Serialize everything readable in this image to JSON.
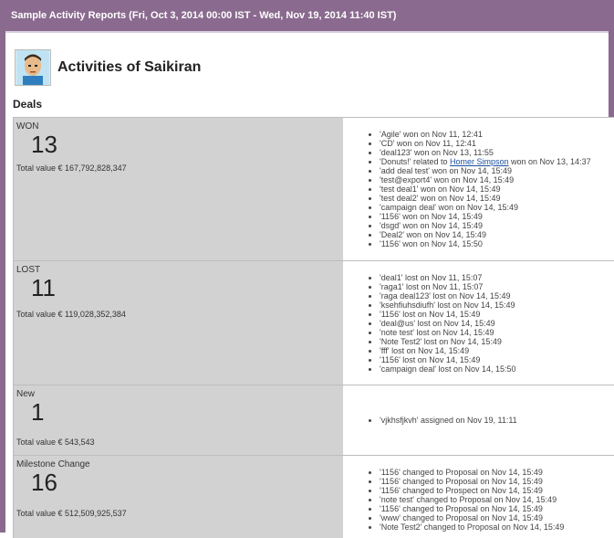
{
  "window": {
    "title": "Sample Activity Reports (Fri, Oct 3, 2014 00:00 IST - Wed, Nov 19, 2014 11:40 IST)"
  },
  "header": {
    "title": "Activities of Saikiran",
    "avatar_icon": "user-avatar-icon"
  },
  "section": {
    "label": "Deals"
  },
  "groups": [
    {
      "name": "WON",
      "count": "13",
      "total": "Total value € 167,792,828,347",
      "items": [
        "'Agile' won on Nov 11, 12:41",
        "'CD' won on Nov 11, 12:41",
        "'deal123' won on Nov 13, 11:55",
        "'add deal test' won on Nov 14, 15:49",
        "'test@export4' won on Nov 14, 15:49",
        "'test deal1' won on Nov 14, 15:49",
        "'test deal2' won on Nov 14, 15:49",
        "'campaign deal' won on Nov 14, 15:49",
        "'1156' won on Nov 14, 15:49",
        "'dsgd' won on Nov 14, 15:49",
        "'Deal2' won on Nov 14, 15:49",
        "'1156' won on Nov 14, 15:50"
      ],
      "special": {
        "pre": "'Donuts!' related to ",
        "link": "Homer Simpson",
        "post": " won on Nov 13, 14:37"
      }
    },
    {
      "name": "LOST",
      "count": "11",
      "total": "Total value € 119,028,352,384",
      "items": [
        "'deal1' lost on Nov 11, 15:07",
        "'raga1' lost on Nov 11, 15:07",
        "'raga deal123' lost on Nov 14, 15:49",
        "'ksehfiuhsdiufh' lost on Nov 14, 15:49",
        "'1156' lost on Nov 14, 15:49",
        "'deal@us' lost on Nov 14, 15:49",
        "'note test' lost on Nov 14, 15:49",
        "'Note Test2' lost on Nov 14, 15:49",
        "'fff' lost on Nov 14, 15:49",
        "'1156' lost on Nov 14, 15:49",
        "'campaign deal' lost on Nov 14, 15:50"
      ]
    },
    {
      "name": "New",
      "count": "1",
      "total": "Total value € 543,543",
      "items": [
        "'vjkhsfjkvh' assigned on Nov 19, 11:11"
      ]
    },
    {
      "name": "Milestone Change",
      "count": "16",
      "total": "Total value € 512,509,925,537",
      "items": [
        "'1156' changed to Proposal on Nov 14, 15:49",
        "'1156' changed to Proposal on Nov 14, 15:49",
        "'1156' changed to Prospect on Nov 14, 15:49",
        "'note test' changed to Proposal on Nov 14, 15:49",
        "'1156' changed to Proposal on Nov 14, 15:49",
        "'www' changed to Proposal on Nov 14, 15:49",
        "'Note Test2' changed to Proposal on Nov 14, 15:49"
      ]
    }
  ]
}
